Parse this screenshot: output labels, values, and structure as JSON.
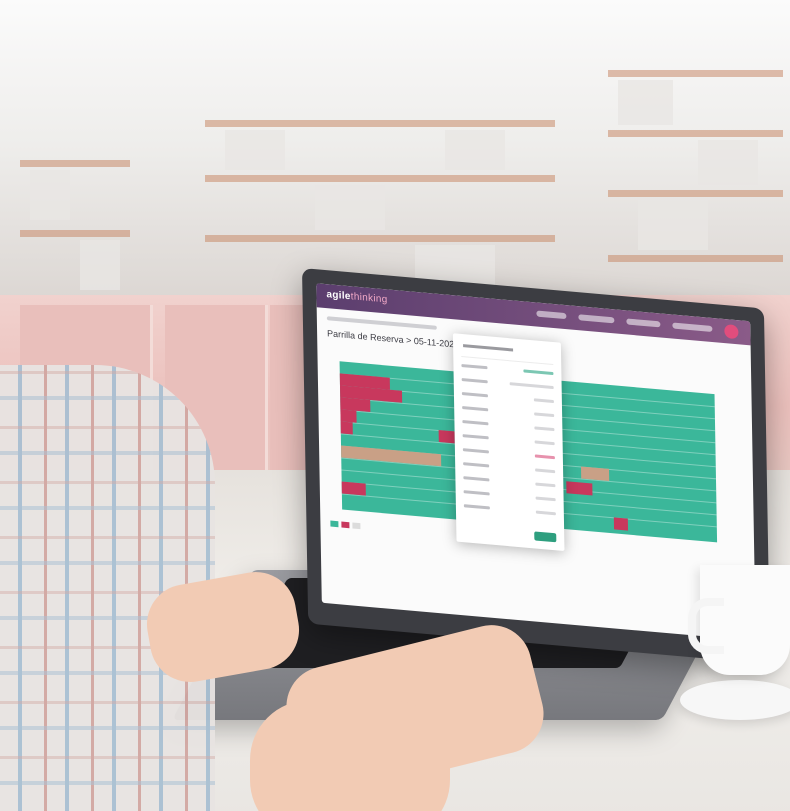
{
  "app": {
    "logo_text": "agile",
    "logo_suffix": "thinking",
    "page_title": "Parrilla de Reserva > 05-11-2021"
  },
  "colors": {
    "header": "#6b4a7a",
    "accent": "#e14d7d",
    "grid_fill": "#3bb79a",
    "reserved": "#c8385d",
    "pending": "#c9a086",
    "confirm_button": "#2e9f7f"
  },
  "icons": [
    "user-avatar-icon"
  ]
}
